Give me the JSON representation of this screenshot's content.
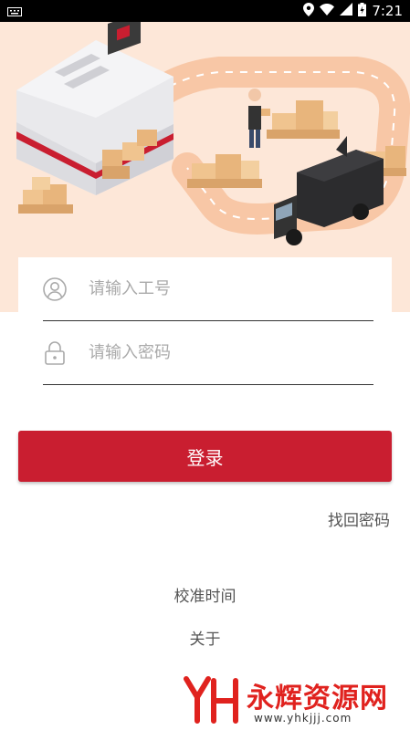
{
  "status_bar": {
    "time": "7:21",
    "icons": [
      "keyboard-icon",
      "location-icon",
      "wifi-icon",
      "signal-icon",
      "battery-icon"
    ]
  },
  "login": {
    "username_placeholder": "请输入工号",
    "password_placeholder": "请输入密码",
    "login_label": "登录",
    "forgot_label": "找回密码",
    "calibrate_label": "校准时间",
    "about_label": "关于"
  },
  "watermark": {
    "name": "永辉资源网",
    "url": "www.yhkjjj.com"
  },
  "colors": {
    "accent": "#c91e30",
    "hero_background": "#fde7d8"
  }
}
